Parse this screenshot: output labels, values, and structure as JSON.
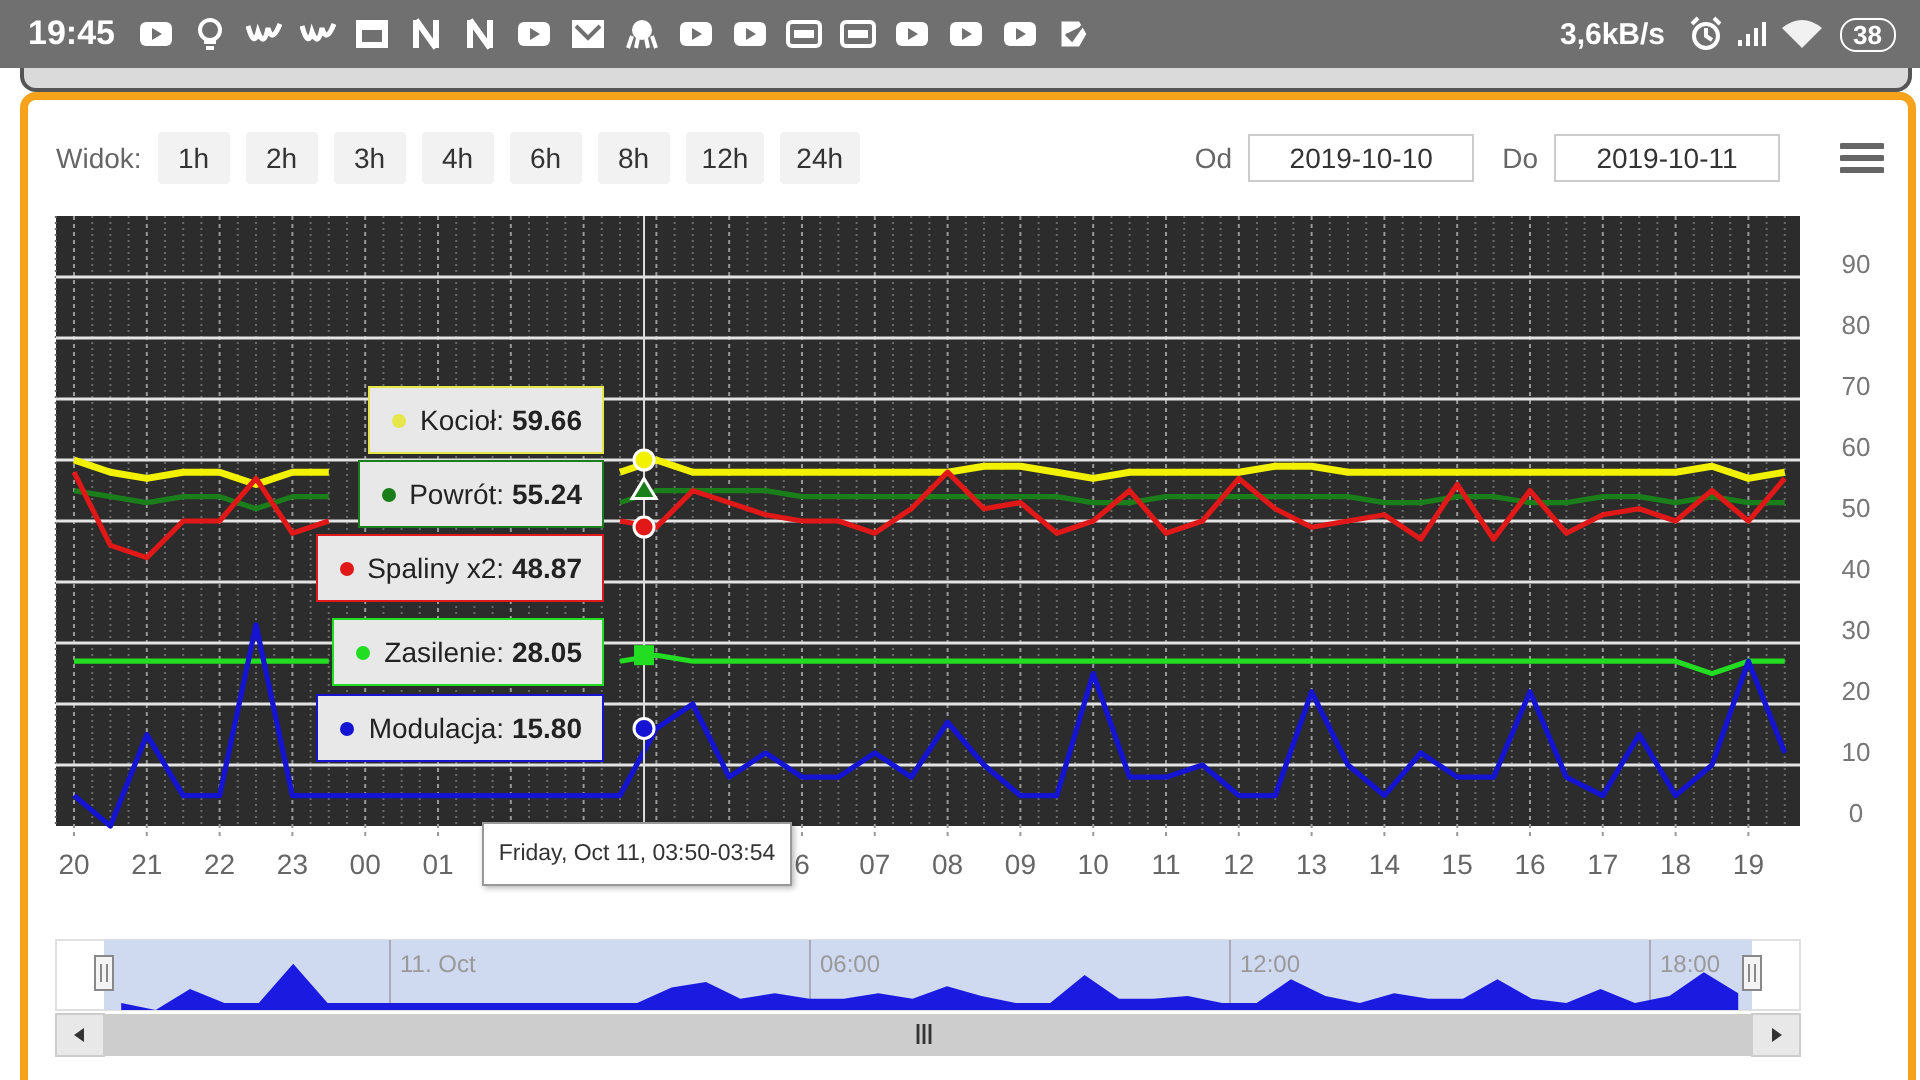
{
  "status_bar": {
    "time": "19:45",
    "net_speed": "3,6kB/s",
    "battery": "38"
  },
  "toolbar": {
    "label": "Widok:",
    "ranges": [
      "1h",
      "2h",
      "3h",
      "4h",
      "6h",
      "8h",
      "12h",
      "24h"
    ],
    "from_label": "Od",
    "from": "2019-10-10",
    "to_label": "Do",
    "to": "2019-10-11"
  },
  "chart": {
    "chart_data": {
      "type": "line",
      "grid": true,
      "ylim": [
        0,
        100
      ],
      "categories": [
        "20",
        null,
        "21",
        null,
        "22",
        null,
        "23",
        null,
        "00",
        null,
        "01",
        null,
        null,
        null,
        null,
        null,
        null,
        null,
        null,
        null,
        "6",
        null,
        "07",
        null,
        "08",
        null,
        "09",
        null,
        "10",
        null,
        "11",
        null,
        "12",
        null,
        "13",
        null,
        "14",
        null,
        "15",
        null,
        "16",
        null,
        "17",
        null,
        "18",
        null,
        "19",
        null
      ],
      "yticks": [
        0,
        10,
        20,
        30,
        40,
        50,
        60,
        70,
        80,
        90
      ],
      "series": [
        {
          "color": "#f2f200",
          "values": [
            60,
            58,
            57,
            58,
            58,
            56,
            58,
            58,
            null,
            null,
            null,
            null,
            null,
            null,
            null,
            58,
            60,
            58,
            58,
            58,
            58,
            58,
            58,
            58,
            58,
            59,
            59,
            58,
            57,
            58,
            58,
            58,
            58,
            59,
            59,
            58,
            58,
            58,
            58,
            58,
            58,
            58,
            58,
            58,
            58,
            59,
            57,
            58
          ]
        },
        {
          "color": "#1a7f1a",
          "values": [
            55,
            54,
            53,
            54,
            54,
            52,
            54,
            54,
            null,
            null,
            null,
            null,
            null,
            null,
            null,
            53,
            55,
            55,
            55,
            55,
            54,
            54,
            54,
            54,
            54,
            54,
            54,
            54,
            53,
            53,
            54,
            54,
            54,
            54,
            54,
            54,
            53,
            53,
            54,
            54,
            53,
            53,
            54,
            54,
            53,
            54,
            53,
            53
          ]
        },
        {
          "color": "#e01818",
          "values": [
            58,
            46,
            44,
            50,
            50,
            57,
            48,
            50,
            null,
            null,
            null,
            null,
            null,
            null,
            null,
            50,
            49,
            55,
            53,
            51,
            50,
            50,
            48,
            52,
            58,
            52,
            53,
            48,
            50,
            55,
            48,
            50,
            57,
            52,
            49,
            50,
            51,
            47,
            56,
            47,
            55,
            48,
            51,
            52,
            50,
            55,
            50,
            57
          ]
        },
        {
          "color": "#22dd22",
          "values": [
            27,
            27,
            27,
            27,
            27,
            27,
            27,
            27,
            null,
            null,
            null,
            null,
            null,
            null,
            null,
            27,
            28,
            27,
            27,
            27,
            27,
            27,
            27,
            27,
            27,
            27,
            27,
            27,
            27,
            27,
            27,
            27,
            27,
            27,
            27,
            27,
            27,
            27,
            27,
            27,
            27,
            27,
            27,
            27,
            27,
            25,
            27,
            27
          ]
        },
        {
          "color": "#1414d2",
          "values": [
            5,
            0,
            15,
            5,
            5,
            33,
            5,
            5,
            5,
            5,
            5,
            5,
            5,
            5,
            5,
            5,
            16,
            20,
            8,
            12,
            8,
            8,
            12,
            8,
            17,
            10,
            5,
            5,
            25,
            8,
            8,
            10,
            5,
            5,
            22,
            10,
            5,
            12,
            8,
            8,
            22,
            8,
            5,
            15,
            5,
            10,
            27,
            12
          ]
        }
      ]
    },
    "crosshair": {
      "label": "Friday, Oct 11, 03:50-03:54"
    },
    "tooltips": [
      {
        "text": "Kocioł: **59.66**",
        "color": "#e6e64a",
        "kind": "circle"
      },
      {
        "text": "Powrót: **55.24**",
        "color": "#1a7f1a",
        "kind": "triangle"
      },
      {
        "text": "Spaliny x2: **48.87**",
        "color": "#e01818",
        "kind": "circle"
      },
      {
        "text": "Zasilenie: **28.05**",
        "color": "#22dd22",
        "kind": "square"
      },
      {
        "text": "Modulacja: **15.80**",
        "color": "#1414d2",
        "kind": "circle"
      }
    ]
  },
  "navigator": {
    "labels": [
      "11. Oct",
      "06:00",
      "12:00",
      "18:00"
    ]
  }
}
